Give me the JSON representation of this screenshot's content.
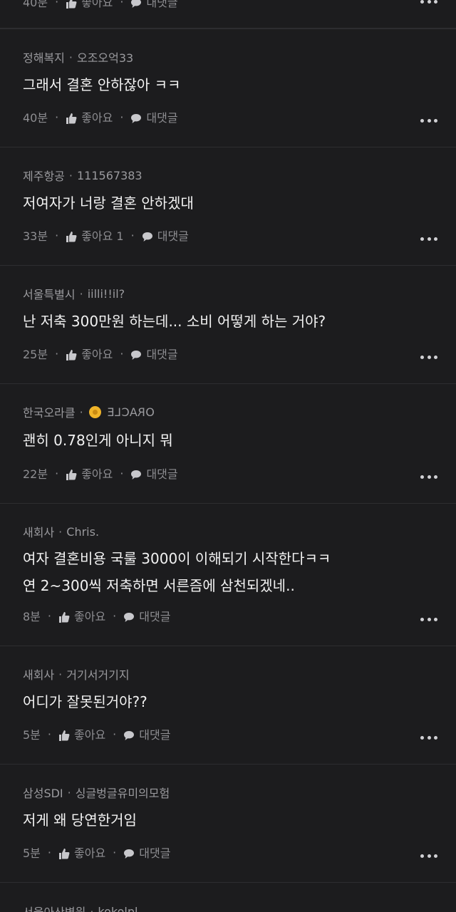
{
  "top_partial": {
    "time": "40분",
    "like": "좋아요",
    "reply": "대댓글"
  },
  "comments": [
    {
      "company": "정해복지",
      "nickname": "오조오억33",
      "lines": [
        "그래서 결혼 안하잖아 ㅋㅋ"
      ],
      "time": "40분",
      "like": "좋아요",
      "reply": "대댓글"
    },
    {
      "company": "제주항공",
      "nickname": "111567383",
      "lines": [
        "저여자가 너랑 결혼 안하겠대"
      ],
      "time": "33분",
      "like": "좋아요 1",
      "reply": "대댓글"
    },
    {
      "company": "서울특별시",
      "nickname": "iilli!!il?",
      "lines": [
        "난 저축 300만원 하는데... 소비 어떻게 하는 거야?"
      ],
      "time": "25분",
      "like": "좋아요",
      "reply": "대댓글"
    },
    {
      "company": "한국오라클",
      "nickname": "ORACLE",
      "lines": [
        "괜히 0.78인게 아니지 뭐"
      ],
      "time": "22분",
      "like": "좋아요",
      "reply": "대댓글"
    },
    {
      "company": "새회사",
      "nickname": "Chris.",
      "lines": [
        "여자 결혼비용 국룰 3000이 이해되기 시작한다ㅋㅋ",
        "연 2~300씩 저축하면 서른즘에 삼천되겠네.."
      ],
      "time": "8분",
      "like": "좋아요",
      "reply": "대댓글"
    },
    {
      "company": "새회사",
      "nickname": "거기서거기지",
      "lines": [
        "어디가 잘못된거야??"
      ],
      "time": "5분",
      "like": "좋아요",
      "reply": "대댓글"
    },
    {
      "company": "삼성SDI",
      "nickname": "싱글벙글유미의모험",
      "lines": [
        "저게 왜 당연한거임"
      ],
      "time": "5분",
      "like": "좋아요",
      "reply": "대댓글"
    },
    {
      "company": "서울아산병원",
      "nickname": "kokolpl",
      "lines": [],
      "time": "",
      "like": "",
      "reply": ""
    }
  ],
  "icons": {
    "like": "thumbs-up-icon",
    "reply": "speech-bubble-icon",
    "more": "more-dots-icon",
    "badge": "gold-badge-icon"
  },
  "colors": {
    "background": "#1c1c1e",
    "divider": "#2d2d30",
    "badge": "#f0b429"
  }
}
